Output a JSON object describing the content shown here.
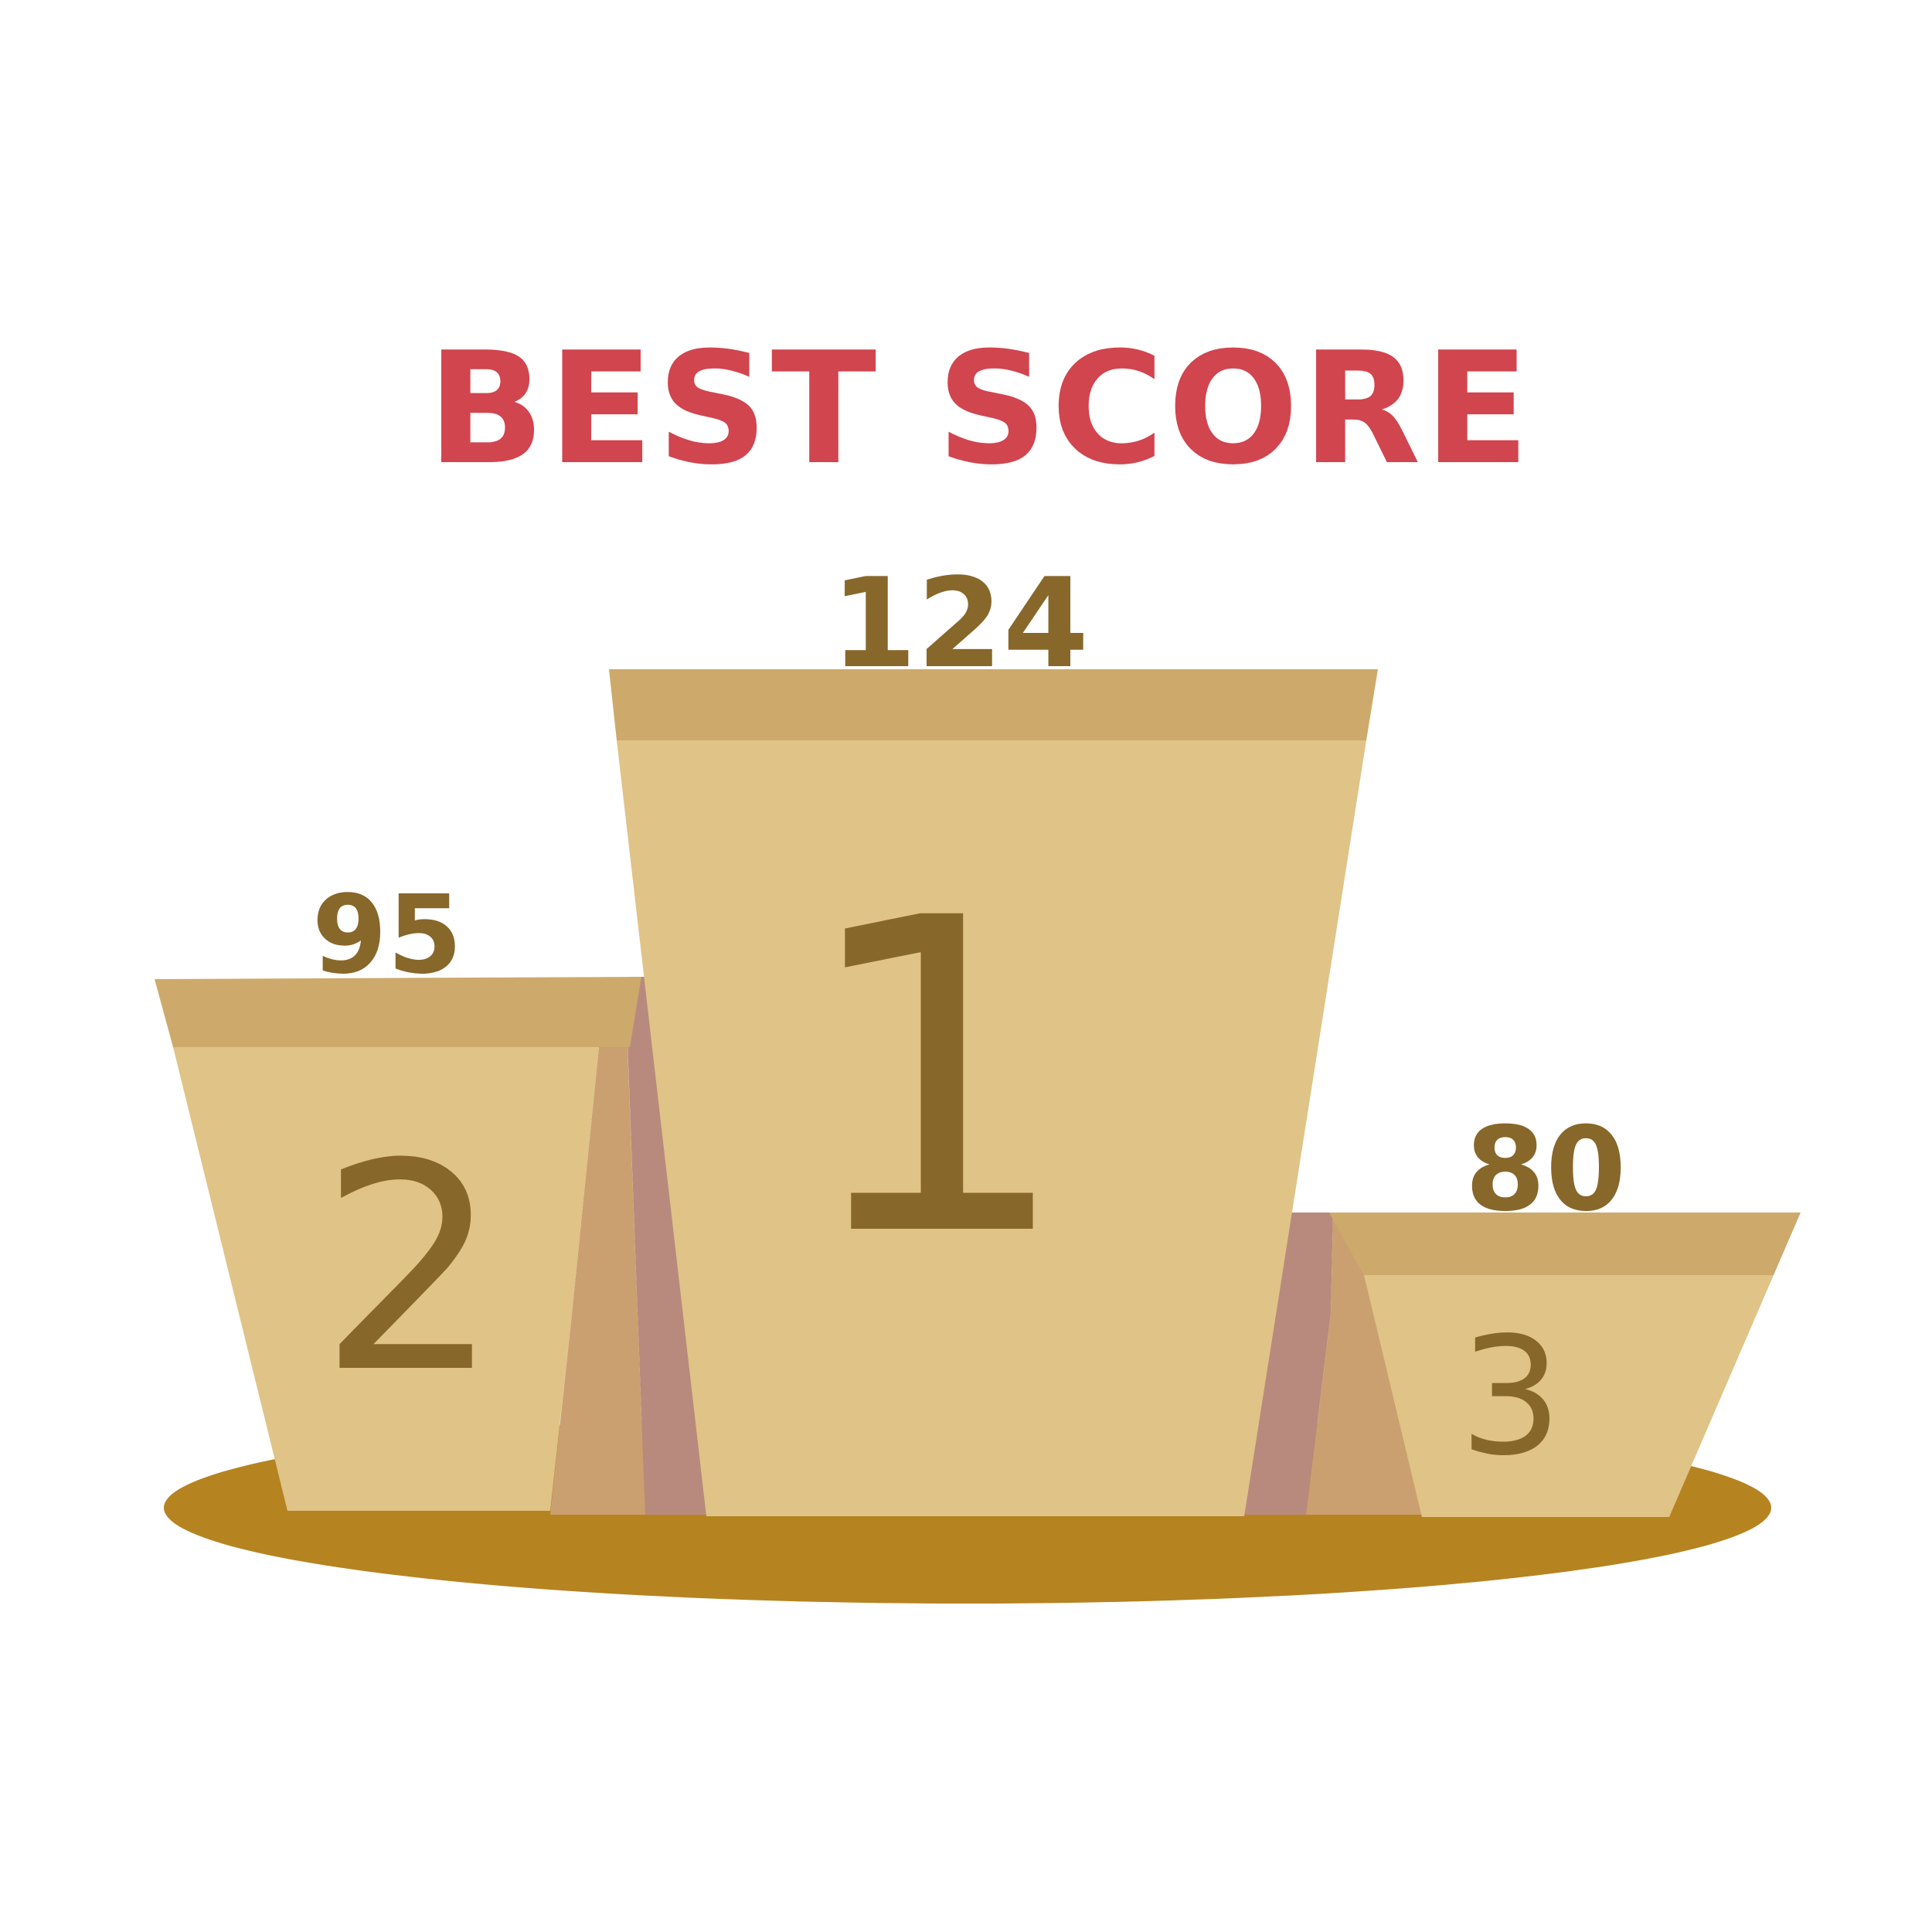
{
  "title": "BEST SCORE",
  "podium": {
    "first": {
      "rank": "1",
      "score": "124"
    },
    "second": {
      "rank": "2",
      "score": "95"
    },
    "third": {
      "rank": "3",
      "score": "80"
    }
  },
  "colors": {
    "title": "#d1454f",
    "text": "#88672a",
    "block_face": "#e0c387",
    "block_band": "#cdaa6b",
    "side_light": "#cba070",
    "side_dark": "#b88a7d",
    "floor": "#b68321",
    "background": "#ffffff"
  }
}
